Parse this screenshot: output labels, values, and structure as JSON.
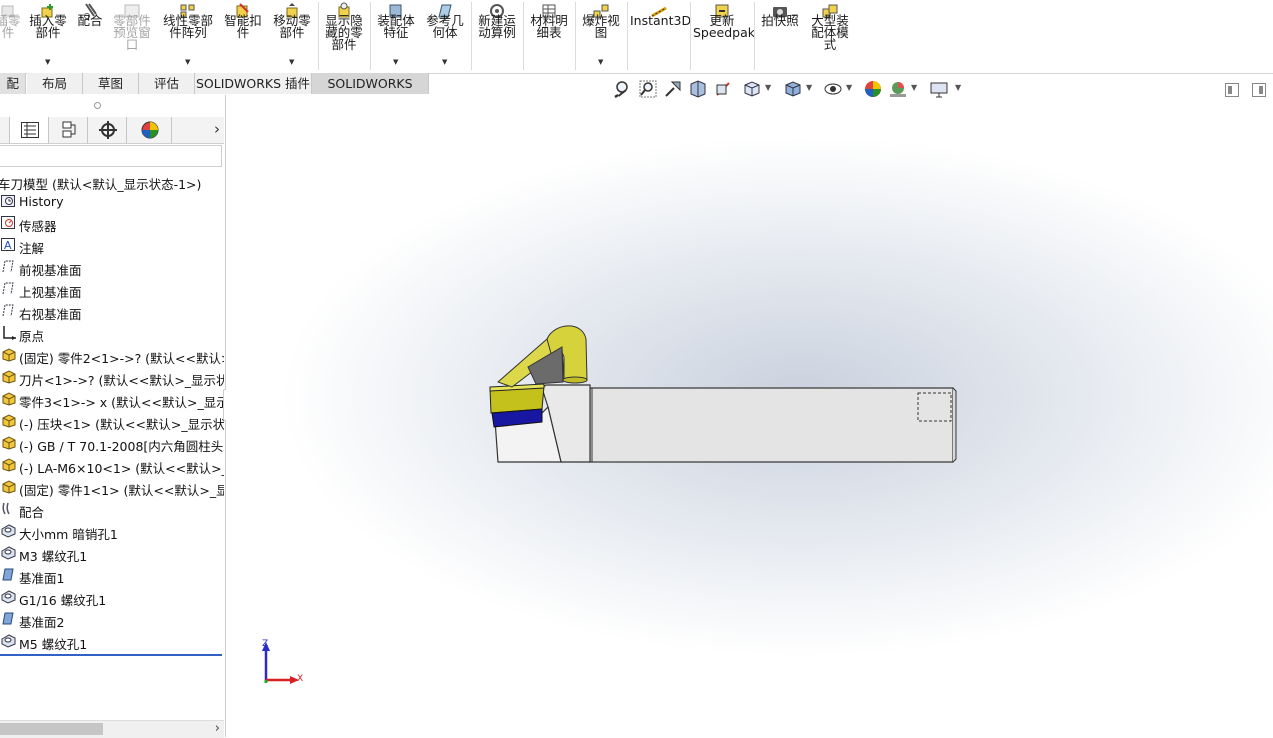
{
  "ribbon": {
    "buttons": [
      {
        "label": "插零\n件",
        "icon": "insert-component-icon",
        "dim": true
      },
      {
        "label": "插入零\n部件",
        "icon": "insert-part-icon"
      },
      {
        "label": "配合",
        "icon": "mate-icon"
      },
      {
        "label": "零部件\n预览窗\n口",
        "icon": "preview-window-icon",
        "dim": true
      },
      {
        "label": "线性零部\n件阵列",
        "icon": "linear-pattern-icon"
      },
      {
        "label": "智能扣\n件",
        "icon": "smart-fastener-icon"
      },
      {
        "label": "移动零\n部件",
        "icon": "move-component-icon"
      },
      {
        "label": "显示隐\n藏的零\n部件",
        "icon": "show-hidden-icon"
      },
      {
        "label": "装配体\n特征",
        "icon": "assembly-feature-icon"
      },
      {
        "label": "参考几\n何体",
        "icon": "reference-geometry-icon"
      },
      {
        "label": "新建运\n动算例",
        "icon": "motion-study-icon"
      },
      {
        "label": "材料明\n细表",
        "icon": "bom-icon"
      },
      {
        "label": "爆炸视\n图",
        "icon": "exploded-view-icon"
      },
      {
        "label": "Instant3D",
        "icon": "instant3d-icon"
      },
      {
        "label": "更新\nSpeedpak",
        "icon": "speedpak-icon"
      },
      {
        "label": "拍快照",
        "icon": "snapshot-icon"
      },
      {
        "label": "大型装\n配体模\n式",
        "icon": "large-assembly-icon"
      }
    ]
  },
  "tabs": [
    "配体",
    "布局",
    "草图",
    "评估",
    "SOLIDWORKS 插件",
    "SOLIDWORKS MBD"
  ],
  "tree": {
    "root": "车刀模型  (默认<默认_显示状态-1>)",
    "items": [
      {
        "label": "History",
        "icon": "history-icon"
      },
      {
        "label": "传感器",
        "icon": "sensor-icon"
      },
      {
        "label": "注解",
        "icon": "annotation-icon"
      },
      {
        "label": "前视基准面",
        "icon": "plane-icon"
      },
      {
        "label": "上视基准面",
        "icon": "plane-icon"
      },
      {
        "label": "右视基准面",
        "icon": "plane-icon"
      },
      {
        "label": "原点",
        "icon": "origin-icon"
      },
      {
        "label": "(固定) 零件2<1>->? (默认<<默认>_显",
        "icon": "part-icon"
      },
      {
        "label": "刀片<1>->? (默认<<默认>_显示状态",
        "icon": "part-icon"
      },
      {
        "label": "零件3<1>-> x (默认<<默认>_显示状",
        "icon": "part-icon"
      },
      {
        "label": "(-) 压块<1> (默认<<默认>_显示状态",
        "icon": "part-icon"
      },
      {
        "label": "(-) GB / T 70.1-2008[内六角圆柱头螺",
        "icon": "part-icon"
      },
      {
        "label": "(-) LA-M6×10<1> (默认<<默认>_显",
        "icon": "part-icon"
      },
      {
        "label": "(固定) 零件1<1> (默认<<默认>_显示",
        "icon": "part-icon"
      },
      {
        "label": "配合",
        "icon": "mates-icon"
      },
      {
        "label": "大小mm 暗销孔1",
        "icon": "hole-icon"
      },
      {
        "label": "M3 螺纹孔1",
        "icon": "hole-icon"
      },
      {
        "label": "基准面1",
        "icon": "ref-plane-icon"
      },
      {
        "label": "G1/16 螺纹孔1",
        "icon": "hole-icon"
      },
      {
        "label": "基准面2",
        "icon": "ref-plane-icon"
      },
      {
        "label": "M5 螺纹孔1",
        "icon": "hole-icon"
      }
    ]
  },
  "hud": {
    "icons": [
      "zoom-to-fit-icon",
      "zoom-area-icon",
      "previous-view-icon",
      "section-view-icon",
      "dynamic-annotation-icon",
      "view-orientation-icon",
      "display-style-icon",
      "hide-show-icon",
      "edit-appearance-icon",
      "apply-scene-icon",
      "view-settings-icon"
    ]
  },
  "triad": {
    "z": "Z",
    "x": "X"
  },
  "colors": {
    "accent": "#2f62c4",
    "part_yellow": "#c8c41a",
    "part_blue": "#1818a0",
    "body_gray": "#e2e2e2"
  }
}
